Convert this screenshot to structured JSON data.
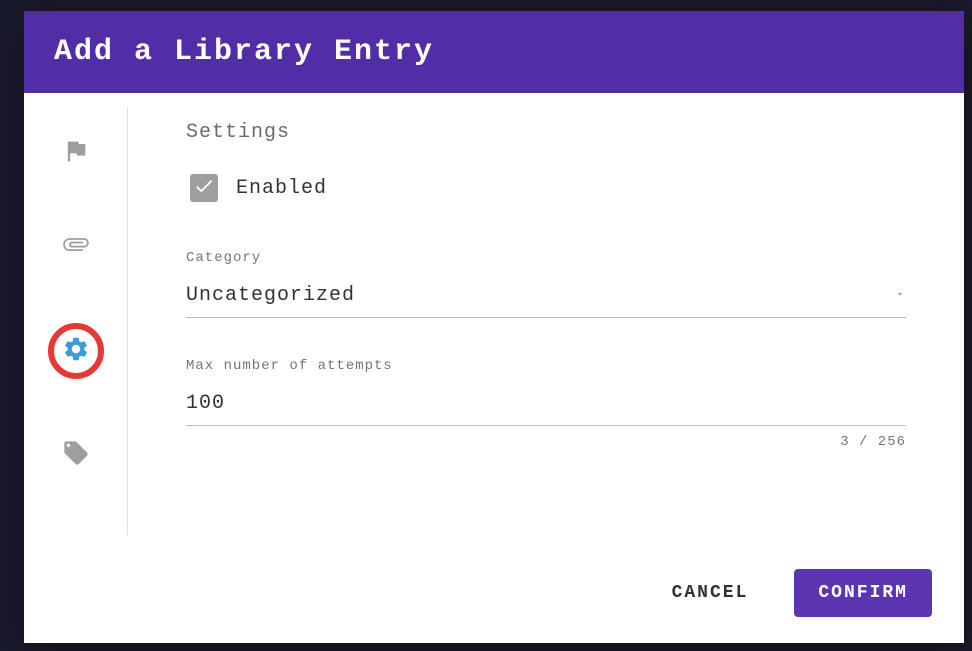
{
  "header": {
    "title": "Add a Library Entry"
  },
  "sidebar": {
    "tabs": [
      {
        "icon": "flag-icon",
        "active": false
      },
      {
        "icon": "attachment-icon",
        "active": false
      },
      {
        "icon": "gear-icon",
        "active": true
      },
      {
        "icon": "tag-icon",
        "active": false
      }
    ]
  },
  "settings": {
    "section_title": "Settings",
    "enabled_label": "Enabled",
    "enabled_value": true,
    "category": {
      "label": "Category",
      "value": "Uncategorized"
    },
    "max_attempts": {
      "label": "Max number of attempts",
      "value": "100",
      "char_count": "3 / 256"
    }
  },
  "footer": {
    "cancel_label": "CANCEL",
    "confirm_label": "CONFIRM"
  },
  "colors": {
    "primary": "#5E35B1",
    "header": "#512DA8",
    "active_ring": "#e53935",
    "active_icon": "#3d9bd8"
  }
}
